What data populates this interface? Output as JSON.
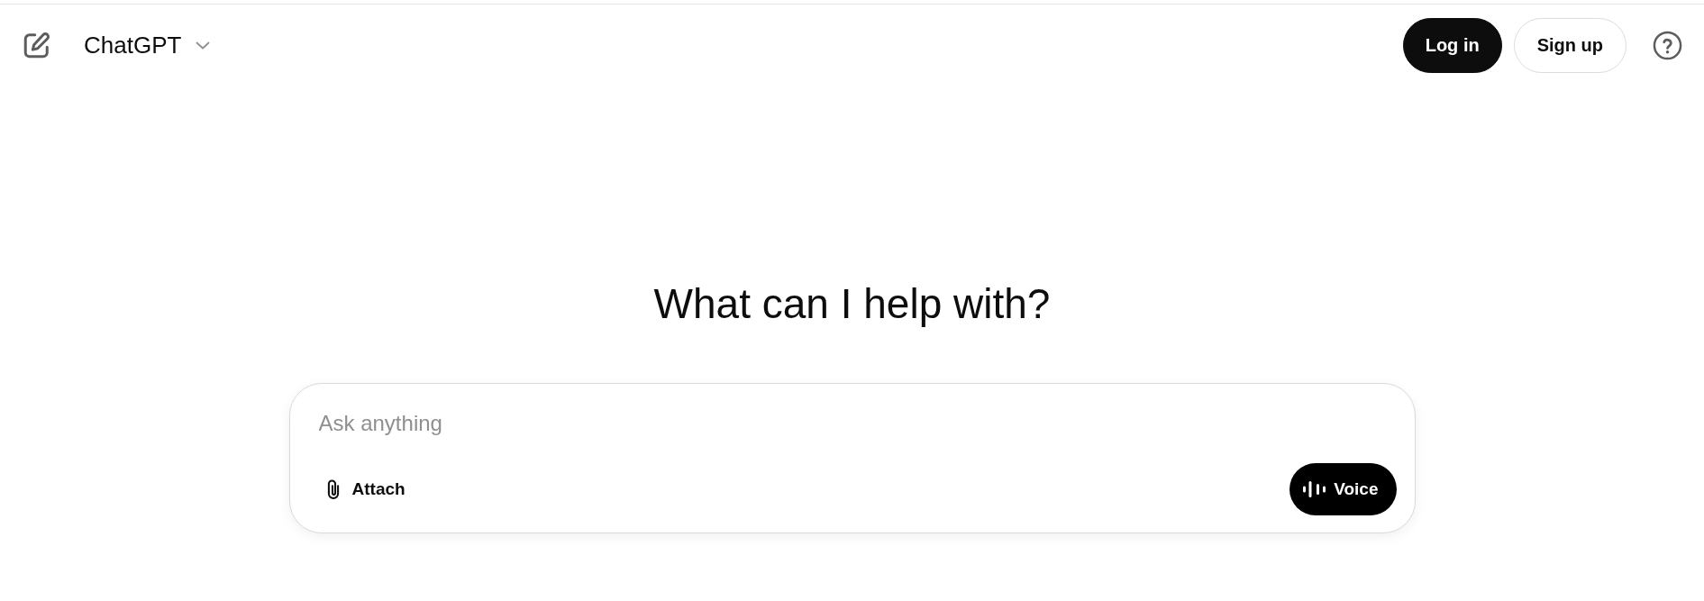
{
  "header": {
    "model_name": "ChatGPT",
    "buttons": [
      {
        "label": "Log in",
        "kind": "primary"
      },
      {
        "label": "Sign up",
        "kind": "secondary"
      }
    ]
  },
  "heading": "What can I help with?",
  "composer": {
    "placeholder": "Ask anything",
    "attach_label": "Attach",
    "voice_label": "Voice"
  }
}
